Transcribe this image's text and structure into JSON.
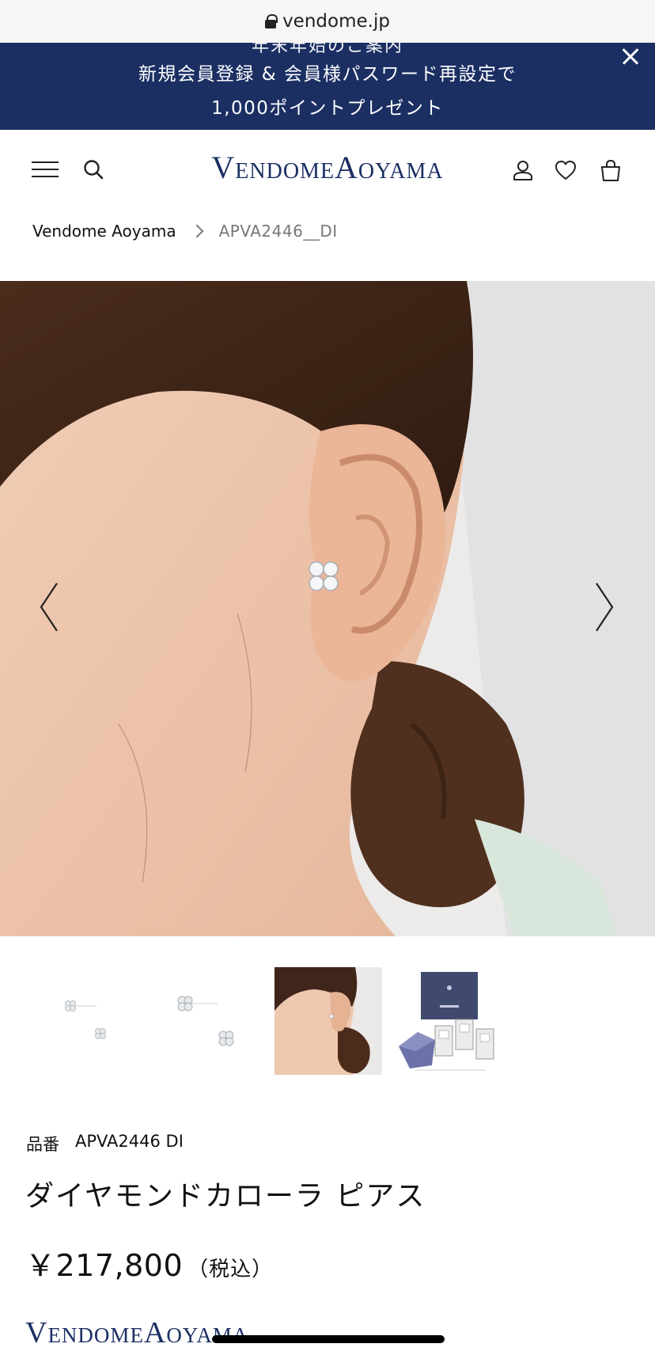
{
  "browser": {
    "url": "vendome.jp"
  },
  "promo": {
    "partial_text": "年末年始のご案内",
    "line1": "新規会員登録 & 会員様パスワード再設定で",
    "line2": "1,000ポイントプレゼント"
  },
  "header": {
    "logo": "VendomeAoyama"
  },
  "breadcrumb": {
    "home": "Vendome Aoyama",
    "current": "APVA2446__DI"
  },
  "product": {
    "sku_label": "品番",
    "sku": "APVA2446 DI",
    "name": "ダイヤモンドカローラ ピアス",
    "price": "￥217,800",
    "tax_note": "（税込）"
  },
  "footer": {
    "logo": "VendomeAoyama"
  },
  "icons": {
    "lock": "lock-icon",
    "close": "close-icon",
    "menu": "menu-icon",
    "search": "search-icon",
    "account": "user-icon",
    "wishlist": "heart-icon",
    "cart": "bag-icon",
    "prev": "chevron-left-icon",
    "next": "chevron-right-icon"
  },
  "colors": {
    "brand_navy": "#1b2f63",
    "banner_text": "#ffffff",
    "breadcrumb_current": "#777777"
  }
}
